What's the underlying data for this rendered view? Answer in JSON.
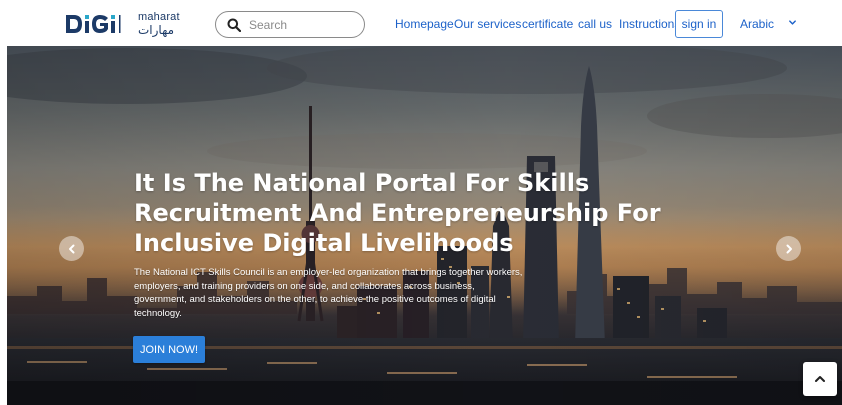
{
  "header": {
    "logo": {
      "main": "DiGi",
      "sub_en": "maharat",
      "sub_ar": "مهارات"
    },
    "search": {
      "placeholder": "Search",
      "icon": "search-icon"
    },
    "nav": [
      {
        "label": "Homepage"
      },
      {
        "label": "Our services"
      },
      {
        "label": "certificate"
      },
      {
        "label": "call us"
      },
      {
        "label": "Instructions"
      }
    ],
    "signin_label": "sign in",
    "language": {
      "label": "Arabic",
      "icon": "chevron-down-icon"
    }
  },
  "hero": {
    "title": "It Is The National Portal For Skills Recruitment And Entrepreneurship For Inclusive Digital Livelihoods",
    "description": "The National ICT Skills Council is an employer-led organization that brings together workers, employers, and training providers on one side, and collaborates across business, government, and stakeholders on the other, to achieve the positive outcomes of digital technology.",
    "cta_label": "JOIN NOW!",
    "prev_icon": "chevron-left-icon",
    "next_icon": "chevron-right-icon"
  },
  "scroll_top_icon": "chevron-up-icon",
  "colors": {
    "brand_navy": "#1c3a67",
    "link_blue": "#1d62c9",
    "cta_blue": "#2b7fd9",
    "hero_text": "#ffffff"
  }
}
